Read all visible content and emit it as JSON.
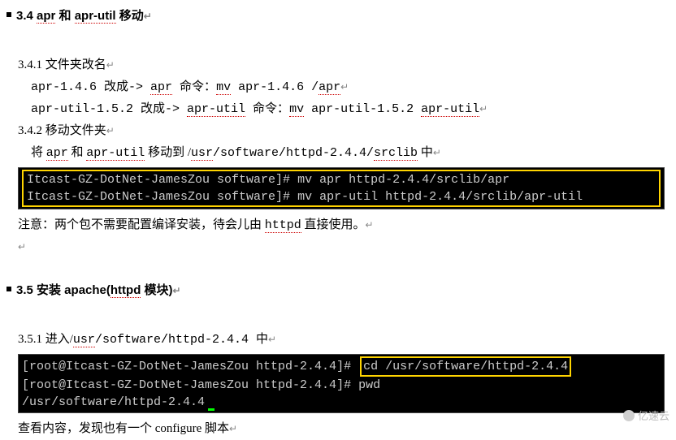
{
  "section34": {
    "header_prefix": "3.4 ",
    "header_apr": "apr",
    "header_and": "  和  ",
    "header_aprutil": "apr-util",
    "header_suffix": "  移动",
    "h1": "3.4.1 文件夹改名",
    "l1_a": "apr-1.4.6 改成-> ",
    "l1_b": "apr",
    "l1_c": "  命令：",
    "l1_d": "mv",
    "l1_e": " apr-1.4.6 /",
    "l1_f": "apr",
    "l2_a": "apr-util-1.5.2 改成-> ",
    "l2_b": "apr-util",
    "l2_c": " 命令：",
    "l2_d": "mv",
    "l2_e": " apr-util-1.5.2 ",
    "l2_f": "apr-util",
    "h2": "3.4.2 移动文件夹",
    "l3_a": "将 ",
    "l3_b": "apr",
    "l3_c": " 和 ",
    "l3_d": "apr-util",
    "l3_e": " 移动到 /",
    "l3_f": "usr",
    "l3_g": "/software/httpd-2.4.4/",
    "l3_h": "srclib",
    "l3_i": " 中",
    "term1_prompt1": "Itcast-GZ-DotNet-JamesZou software]# ",
    "term1_cmd1": "mv apr httpd-2.4.4/srclib/apr",
    "term1_prompt2": "Itcast-GZ-DotNet-JamesZou software]# ",
    "term1_cmd2": "mv apr-util httpd-2.4.4/srclib/apr-util",
    "note_a": "注意：两个包不需要配置编译安装，待会儿由 ",
    "note_b": "httpd",
    "note_c": " 直接使用。"
  },
  "section35": {
    "header_prefix": "3.5  安装 apache(",
    "header_httpd": "httpd",
    "header_suffix": " 模块)",
    "h1_a": "3.5.1 进入/",
    "h1_b": "usr",
    "h1_c": "/software/httpd-2.4.4 中",
    "term2_prompt1": "[root@Itcast-GZ-DotNet-JamesZou httpd-2.4.4]# ",
    "term2_cmd1": "cd /usr/software/httpd-2.4.4",
    "term2_prompt2": "[root@Itcast-GZ-DotNet-JamesZou httpd-2.4.4]# ",
    "term2_cmd2": "pwd",
    "term2_out": "/usr/software/httpd-2.4.4",
    "l1_a": "查看内容，发现也有一个  configure 脚本"
  },
  "watermark": "亿速云"
}
